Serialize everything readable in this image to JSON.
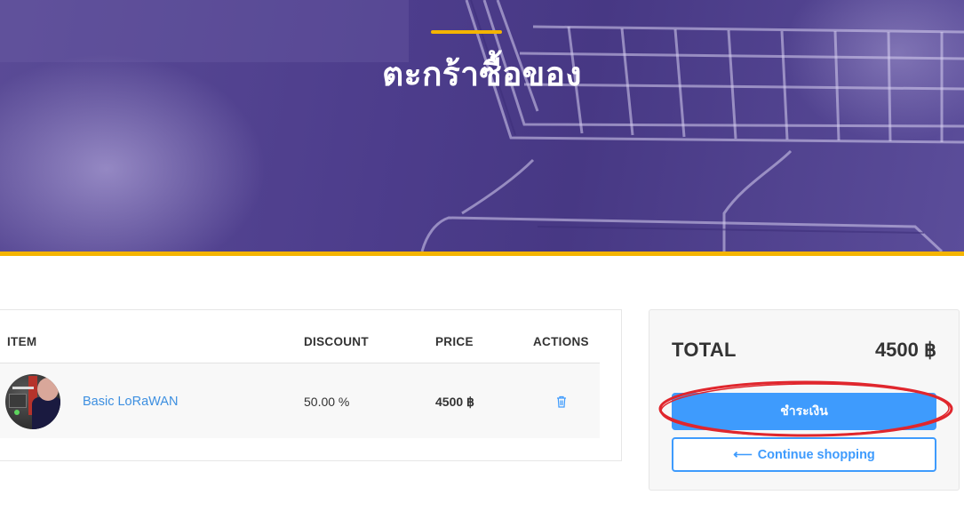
{
  "hero": {
    "title": "ตะกร้าซื้อของ"
  },
  "cart": {
    "columns": {
      "item": "ITEM",
      "discount": "DISCOUNT",
      "price": "PRICE",
      "actions": "ACTIONS"
    },
    "rows": [
      {
        "name": "Basic LoRaWAN",
        "discount": "50.00 %",
        "price": "4500 ฿",
        "action_icon": "trash-icon"
      }
    ]
  },
  "summary": {
    "total_label": "TOTAL",
    "total_value": "4500 ฿",
    "pay_label": "ชำระเงิน",
    "continue_label": "Continue shopping",
    "continue_icon": "arrow-left-icon"
  },
  "colors": {
    "hero_bg": "#4d3d8c",
    "accent": "#f4b400",
    "primary": "#3e9bfd",
    "annotation": "#e0262d"
  }
}
